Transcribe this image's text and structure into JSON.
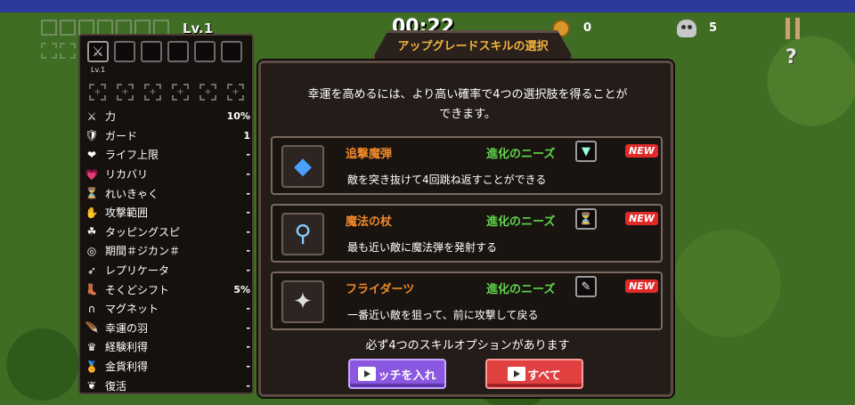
{
  "hud": {
    "level": "Lv.1",
    "timer": "00:22",
    "coins": "0",
    "kills": "5",
    "help": "?"
  },
  "stats_panel": {
    "weapon_level": "Lv.1",
    "stats": [
      {
        "icon": "sword-icon",
        "glyph": "⚔",
        "name": "力",
        "value": "10%"
      },
      {
        "icon": "shield-icon",
        "glyph": "🛡",
        "name": "ガード",
        "value": "1"
      },
      {
        "icon": "heart-icon",
        "glyph": "❤",
        "name": "ライフ上限",
        "value": "-"
      },
      {
        "icon": "heart-plus-icon",
        "glyph": "💗",
        "name": "リカバリ",
        "value": "-"
      },
      {
        "icon": "cooldown-icon",
        "glyph": "⏳",
        "name": "れいきゃく",
        "value": "-"
      },
      {
        "icon": "range-icon",
        "glyph": "✋",
        "name": "攻撃範囲",
        "value": "-"
      },
      {
        "icon": "tapping-icon",
        "glyph": "☘",
        "name": "タッピングスピ",
        "value": "-"
      },
      {
        "icon": "duration-icon",
        "glyph": "◎",
        "name": "期間＃ジカン＃",
        "value": "-"
      },
      {
        "icon": "replicator-icon",
        "glyph": "➶",
        "name": "レプリケータ",
        "value": "-"
      },
      {
        "icon": "boot-icon",
        "glyph": "👢",
        "name": "そくどシフト",
        "value": "5%"
      },
      {
        "icon": "magnet-icon",
        "glyph": "∩",
        "name": "マグネット",
        "value": "-"
      },
      {
        "icon": "feather-icon",
        "glyph": "🪶",
        "name": "幸運の羽",
        "value": "-"
      },
      {
        "icon": "crown-icon",
        "glyph": "♛",
        "name": "経験利得",
        "value": "-"
      },
      {
        "icon": "medal-icon",
        "glyph": "🏅",
        "name": "金貨利得",
        "value": "-"
      },
      {
        "icon": "wings-icon",
        "glyph": "❦",
        "name": "復活",
        "value": "-"
      }
    ]
  },
  "dialog": {
    "title": "アップグレードスキルの選択",
    "description_line1": "幸運を高めるには、より高い確率で4つの選択肢を得ることが",
    "description_line2": "できます。",
    "skills": [
      {
        "name": "追撃魔弾",
        "evolution_label": "進化のニーズ",
        "badge": "NEW",
        "description": "敵を突き抜けて4回跳ね返すことができる",
        "icon": "blue-gem-icon",
        "evo_icon": "shield-icon"
      },
      {
        "name": "魔法の杖",
        "evolution_label": "進化のニーズ",
        "badge": "NEW",
        "description": "最も近い敵に魔法弾を発射する",
        "icon": "magic-wand-icon",
        "evo_icon": "cooldown-icon"
      },
      {
        "name": "フライダーツ",
        "evolution_label": "進化のニーズ",
        "badge": "NEW",
        "description": "一番近い敵を狙って、前に攻撃して戻る",
        "icon": "shuriken-icon",
        "evo_icon": "feather-icon"
      }
    ],
    "footer_text": "必ず4つのスキルオプションがあります",
    "watch_button": "ッチを入れ",
    "all_button": "すべて"
  },
  "colors": {
    "skill_name": "#f08a2a",
    "evolution": "#5fd64a",
    "title": "#f0b33a",
    "watch_button": "#8a57e0",
    "all_button": "#e0403f"
  }
}
